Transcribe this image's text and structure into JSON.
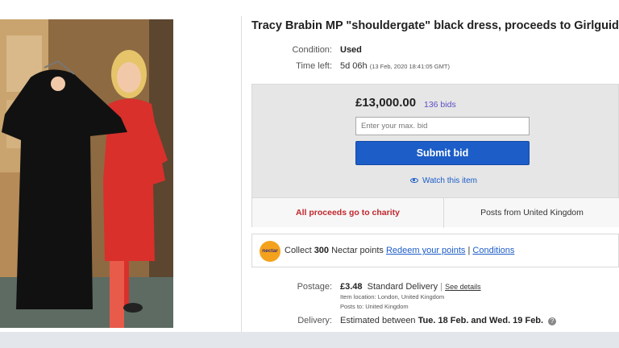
{
  "listing": {
    "title": "Tracy Brabin MP \"shouldergate\" black dress, proceeds to Girlguiding a",
    "condition_label": "Condition:",
    "condition_value": "Used",
    "time_left_label": "Time left:",
    "time_left_value": "5d 06h",
    "time_left_detail": "(13 Feb, 2020   18:41:05 GMT)"
  },
  "bid": {
    "price": "£13,000.00",
    "bids_link": "136 bids",
    "input_placeholder": "Enter your max. bid",
    "submit_label": "Submit bid",
    "watch_label": "Watch this item",
    "charity_text": "All proceeds go to charity",
    "posts_from": "Posts from United Kingdom"
  },
  "nectar": {
    "logo_text": "nectar",
    "collect_prefix": "Collect ",
    "points": "300",
    "collect_suffix": " Nectar points ",
    "redeem_link": "Redeem your points",
    "separator": " | ",
    "conditions_link": "Conditions"
  },
  "postage": {
    "label": "Postage:",
    "price": "£3.48",
    "service": "Standard Delivery",
    "separator": "|",
    "details_link": "See details",
    "item_location": "Item location:  London, United Kingdom",
    "posts_to": "Posts to:  United Kingdom"
  },
  "delivery": {
    "label": "Delivery:",
    "prefix": "Estimated between ",
    "range": "Tue. 18 Feb. and Wed. 19 Feb.",
    "info_icon": "?"
  },
  "colors": {
    "accent_blue": "#1c5dc8",
    "charity_red": "#c0272d",
    "bids_purple": "#5a4fc4",
    "nectar_orange": "#f4a21d"
  }
}
